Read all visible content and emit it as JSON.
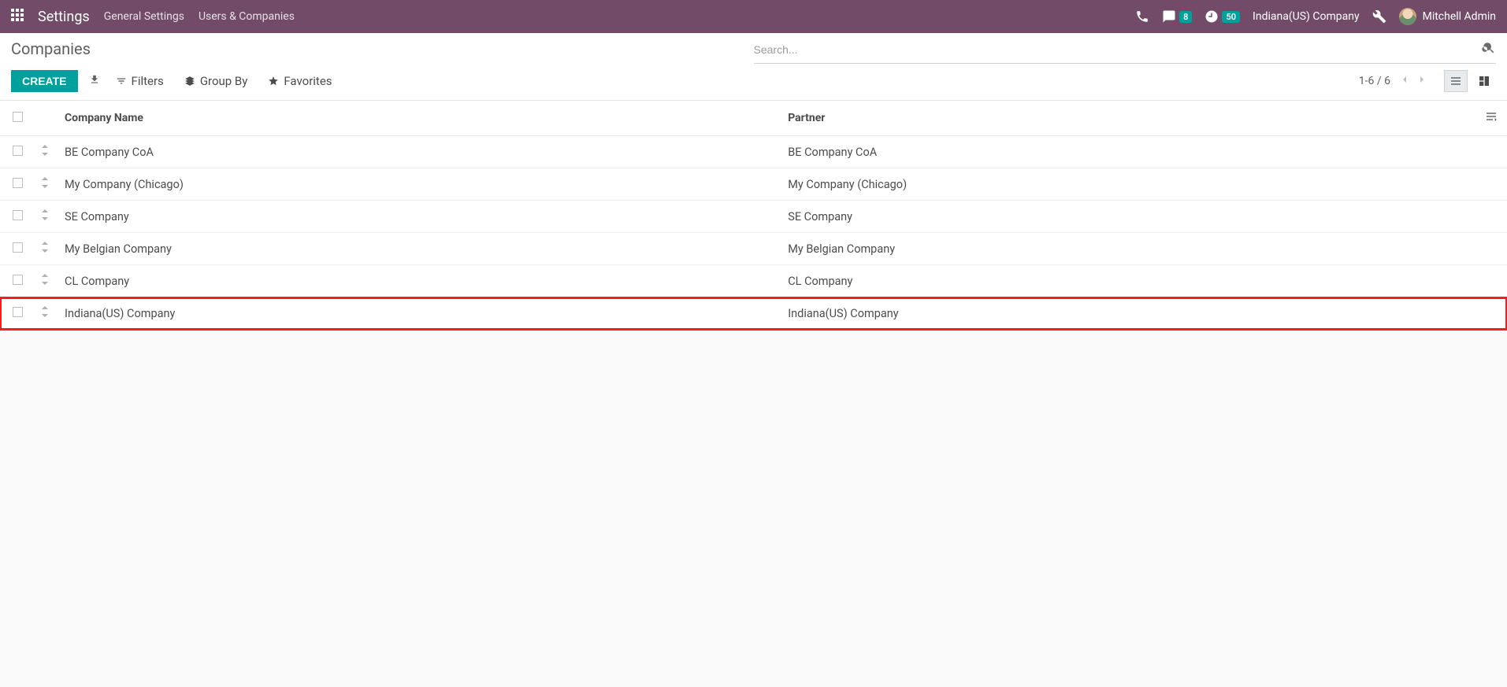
{
  "navbar": {
    "brand": "Settings",
    "menu": [
      "General Settings",
      "Users & Companies"
    ],
    "messages_badge": "8",
    "activities_badge": "50",
    "company": "Indiana(US) Company",
    "user": "Mitchell Admin"
  },
  "breadcrumb": "Companies",
  "buttons": {
    "create": "CREATE"
  },
  "search": {
    "placeholder": "Search..."
  },
  "search_options": {
    "filters": "Filters",
    "group_by": "Group By",
    "favorites": "Favorites"
  },
  "pager": "1-6 / 6",
  "columns": {
    "name": "Company Name",
    "partner": "Partner"
  },
  "rows": [
    {
      "name": "BE Company CoA",
      "partner": "BE Company CoA",
      "highlight": false
    },
    {
      "name": "My Company (Chicago)",
      "partner": "My Company (Chicago)",
      "highlight": false
    },
    {
      "name": "SE Company",
      "partner": "SE Company",
      "highlight": false
    },
    {
      "name": "My Belgian Company",
      "partner": "My Belgian Company",
      "highlight": false
    },
    {
      "name": "CL Company",
      "partner": "CL Company",
      "highlight": false
    },
    {
      "name": "Indiana(US) Company",
      "partner": "Indiana(US) Company",
      "highlight": true
    }
  ]
}
